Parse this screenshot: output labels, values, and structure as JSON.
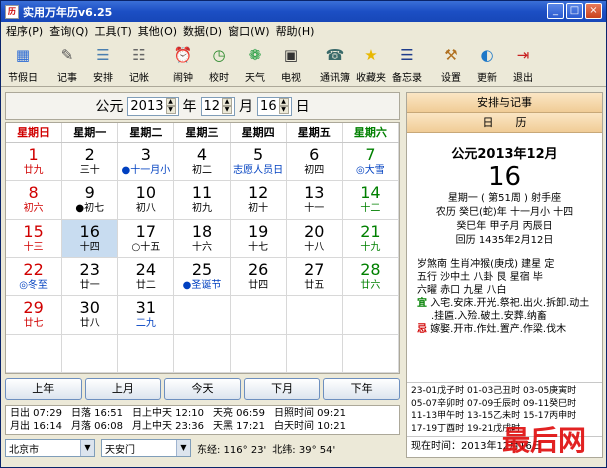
{
  "window": {
    "title": "实用万年历v6.25",
    "icon": "calendar-app-icon"
  },
  "menu": [
    "程序(P)",
    "查询(Q)",
    "工具(T)",
    "其他(O)",
    "数据(D)",
    "窗口(W)",
    "帮助(H)"
  ],
  "toolbar": [
    {
      "label": "节假日",
      "icon": "holiday-calendar-icon",
      "glyph": "▦",
      "color": "#2c6bd6"
    },
    {
      "label": "记事",
      "icon": "notebook-icon",
      "glyph": "✎",
      "color": "#555"
    },
    {
      "label": "安排",
      "icon": "schedule-icon",
      "glyph": "☰",
      "color": "#4a7fb0"
    },
    {
      "label": "记帐",
      "icon": "ledger-icon",
      "glyph": "☷",
      "color": "#666"
    },
    {
      "label": "闹钟",
      "icon": "alarm-clock-icon",
      "glyph": "⏰",
      "color": "#c82020"
    },
    {
      "label": "校时",
      "icon": "time-sync-icon",
      "glyph": "◷",
      "color": "#2c8a2c"
    },
    {
      "label": "天气",
      "icon": "weather-icon",
      "glyph": "❁",
      "color": "#1a9a3a"
    },
    {
      "label": "电视",
      "icon": "tv-icon",
      "glyph": "▣",
      "color": "#333"
    },
    {
      "label": "通讯簿",
      "icon": "address-book-icon",
      "glyph": "☎",
      "color": "#3a6a6a"
    },
    {
      "label": "收藏夹",
      "icon": "favorites-star-icon",
      "glyph": "★",
      "color": "#e8b800"
    },
    {
      "label": "备忘录",
      "icon": "memo-icon",
      "glyph": "☰",
      "color": "#1e3c8c"
    },
    {
      "label": "设置",
      "icon": "settings-tools-icon",
      "glyph": "⚒",
      "color": "#b07020"
    },
    {
      "label": "更新",
      "icon": "update-globe-icon",
      "glyph": "◐",
      "color": "#1e78c8"
    },
    {
      "label": "退出",
      "icon": "exit-door-icon",
      "glyph": "⇥",
      "color": "#c82020"
    }
  ],
  "nav": {
    "prefix": "公元",
    "year": "2013",
    "year_unit": "年",
    "month": "12",
    "month_unit": "月",
    "day": "16",
    "day_unit": "日"
  },
  "weekdays": [
    {
      "label": "星期日",
      "color": "#d00000"
    },
    {
      "label": "星期一",
      "color": "#000"
    },
    {
      "label": "星期二",
      "color": "#000"
    },
    {
      "label": "星期三",
      "color": "#000"
    },
    {
      "label": "星期四",
      "color": "#000"
    },
    {
      "label": "星期五",
      "color": "#000"
    },
    {
      "label": "星期六",
      "color": "#008000"
    }
  ],
  "days": [
    {
      "d": "1",
      "l": "廿九",
      "c": "red",
      "lc": "red"
    },
    {
      "d": "2",
      "l": "三十",
      "c": "",
      "lc": ""
    },
    {
      "d": "3",
      "l": "●十一月小",
      "c": "",
      "lc": "blue"
    },
    {
      "d": "4",
      "l": "初二",
      "c": "",
      "lc": ""
    },
    {
      "d": "5",
      "l": "志愿人员日",
      "c": "",
      "lc": "blue"
    },
    {
      "d": "6",
      "l": "初四",
      "c": "",
      "lc": ""
    },
    {
      "d": "7",
      "l": "◎大雪",
      "c": "green",
      "lc": "blue"
    },
    {
      "d": "8",
      "l": "初六",
      "c": "red",
      "lc": "red"
    },
    {
      "d": "9",
      "l": "●初七",
      "c": "",
      "lc": ""
    },
    {
      "d": "10",
      "l": "初八",
      "c": "",
      "lc": ""
    },
    {
      "d": "11",
      "l": "初九",
      "c": "",
      "lc": ""
    },
    {
      "d": "12",
      "l": "初十",
      "c": "",
      "lc": ""
    },
    {
      "d": "13",
      "l": "十一",
      "c": "",
      "lc": ""
    },
    {
      "d": "14",
      "l": "十二",
      "c": "green",
      "lc": "green"
    },
    {
      "d": "15",
      "l": "十三",
      "c": "red",
      "lc": "red"
    },
    {
      "d": "16",
      "l": "十四",
      "c": "",
      "lc": "",
      "today": true
    },
    {
      "d": "17",
      "l": "○十五",
      "c": "",
      "lc": ""
    },
    {
      "d": "18",
      "l": "十六",
      "c": "",
      "lc": ""
    },
    {
      "d": "19",
      "l": "十七",
      "c": "",
      "lc": ""
    },
    {
      "d": "20",
      "l": "十八",
      "c": "",
      "lc": ""
    },
    {
      "d": "21",
      "l": "十九",
      "c": "green",
      "lc": "green"
    },
    {
      "d": "22",
      "l": "◎冬至",
      "c": "red",
      "lc": "blue"
    },
    {
      "d": "23",
      "l": "廿一",
      "c": "",
      "lc": ""
    },
    {
      "d": "24",
      "l": "廿二",
      "c": "",
      "lc": ""
    },
    {
      "d": "25",
      "l": "●圣诞节",
      "c": "",
      "lc": "blue"
    },
    {
      "d": "26",
      "l": "廿四",
      "c": "",
      "lc": ""
    },
    {
      "d": "27",
      "l": "廿五",
      "c": "",
      "lc": ""
    },
    {
      "d": "28",
      "l": "廿六",
      "c": "green",
      "lc": "green"
    },
    {
      "d": "29",
      "l": "廿七",
      "c": "red",
      "lc": "red"
    },
    {
      "d": "30",
      "l": "廿八",
      "c": "",
      "lc": ""
    },
    {
      "d": "31",
      "l": "二九",
      "c": "",
      "lc": "blue"
    }
  ],
  "buttons": {
    "prev_year": "上年",
    "prev_month": "上月",
    "today": "今天",
    "next_month": "下月",
    "next_year": "下年"
  },
  "sun": {
    "row1": [
      "日出 07:29",
      "日落 16:51",
      "日上中天 12:10",
      "天亮 06:59",
      "日照时间 09:21"
    ],
    "row2": [
      "月出 16:14",
      "月落 06:08",
      "月上中天 23:36",
      "天黑 17:21",
      "白天时间 10:21"
    ]
  },
  "location": {
    "city": "北京市",
    "place": "天安门",
    "lng": "东经: 116° 23'",
    "lat": "北纬: 39° 54'"
  },
  "right": {
    "tab1": "安排与记事",
    "tab2": "日　　历",
    "ym": "公元2013年12月",
    "day": "16",
    "lines": [
      "星期一 ( 第51周 ) 射手座",
      "农历 癸巳(蛇)年 十一月小 十四",
      "癸巳年 甲子月 丙辰日",
      "回历 1435年2月12日"
    ],
    "yiji": [
      "岁煞南 生肖冲猴(庚戌) 建星 定",
      "五行 沙中土 八卦 艮 星宿 毕",
      "六曜 赤口 九星 八白"
    ],
    "yi_tag": "宜",
    "yi": "入宅.安床.开光.祭祀.出火.拆卸.动土",
    "yi2": ".挂匾.入殓.破土.安葬.纳畜",
    "ji_tag": "忌",
    "ji": "嫁娶.开市.作灶.置产.作梁.伐木",
    "shichen": [
      "23-01戊子时 01-03己丑时 03-05庚寅时",
      "05-07辛卯时 07-09壬辰时 09-11癸巳时",
      "11-13甲午时 13-15乙未时 15-17丙申时",
      "17-19丁酉时 19-21戊戌时"
    ],
    "now": "现在时间：2013年12月16日"
  },
  "watermark": "最后网"
}
